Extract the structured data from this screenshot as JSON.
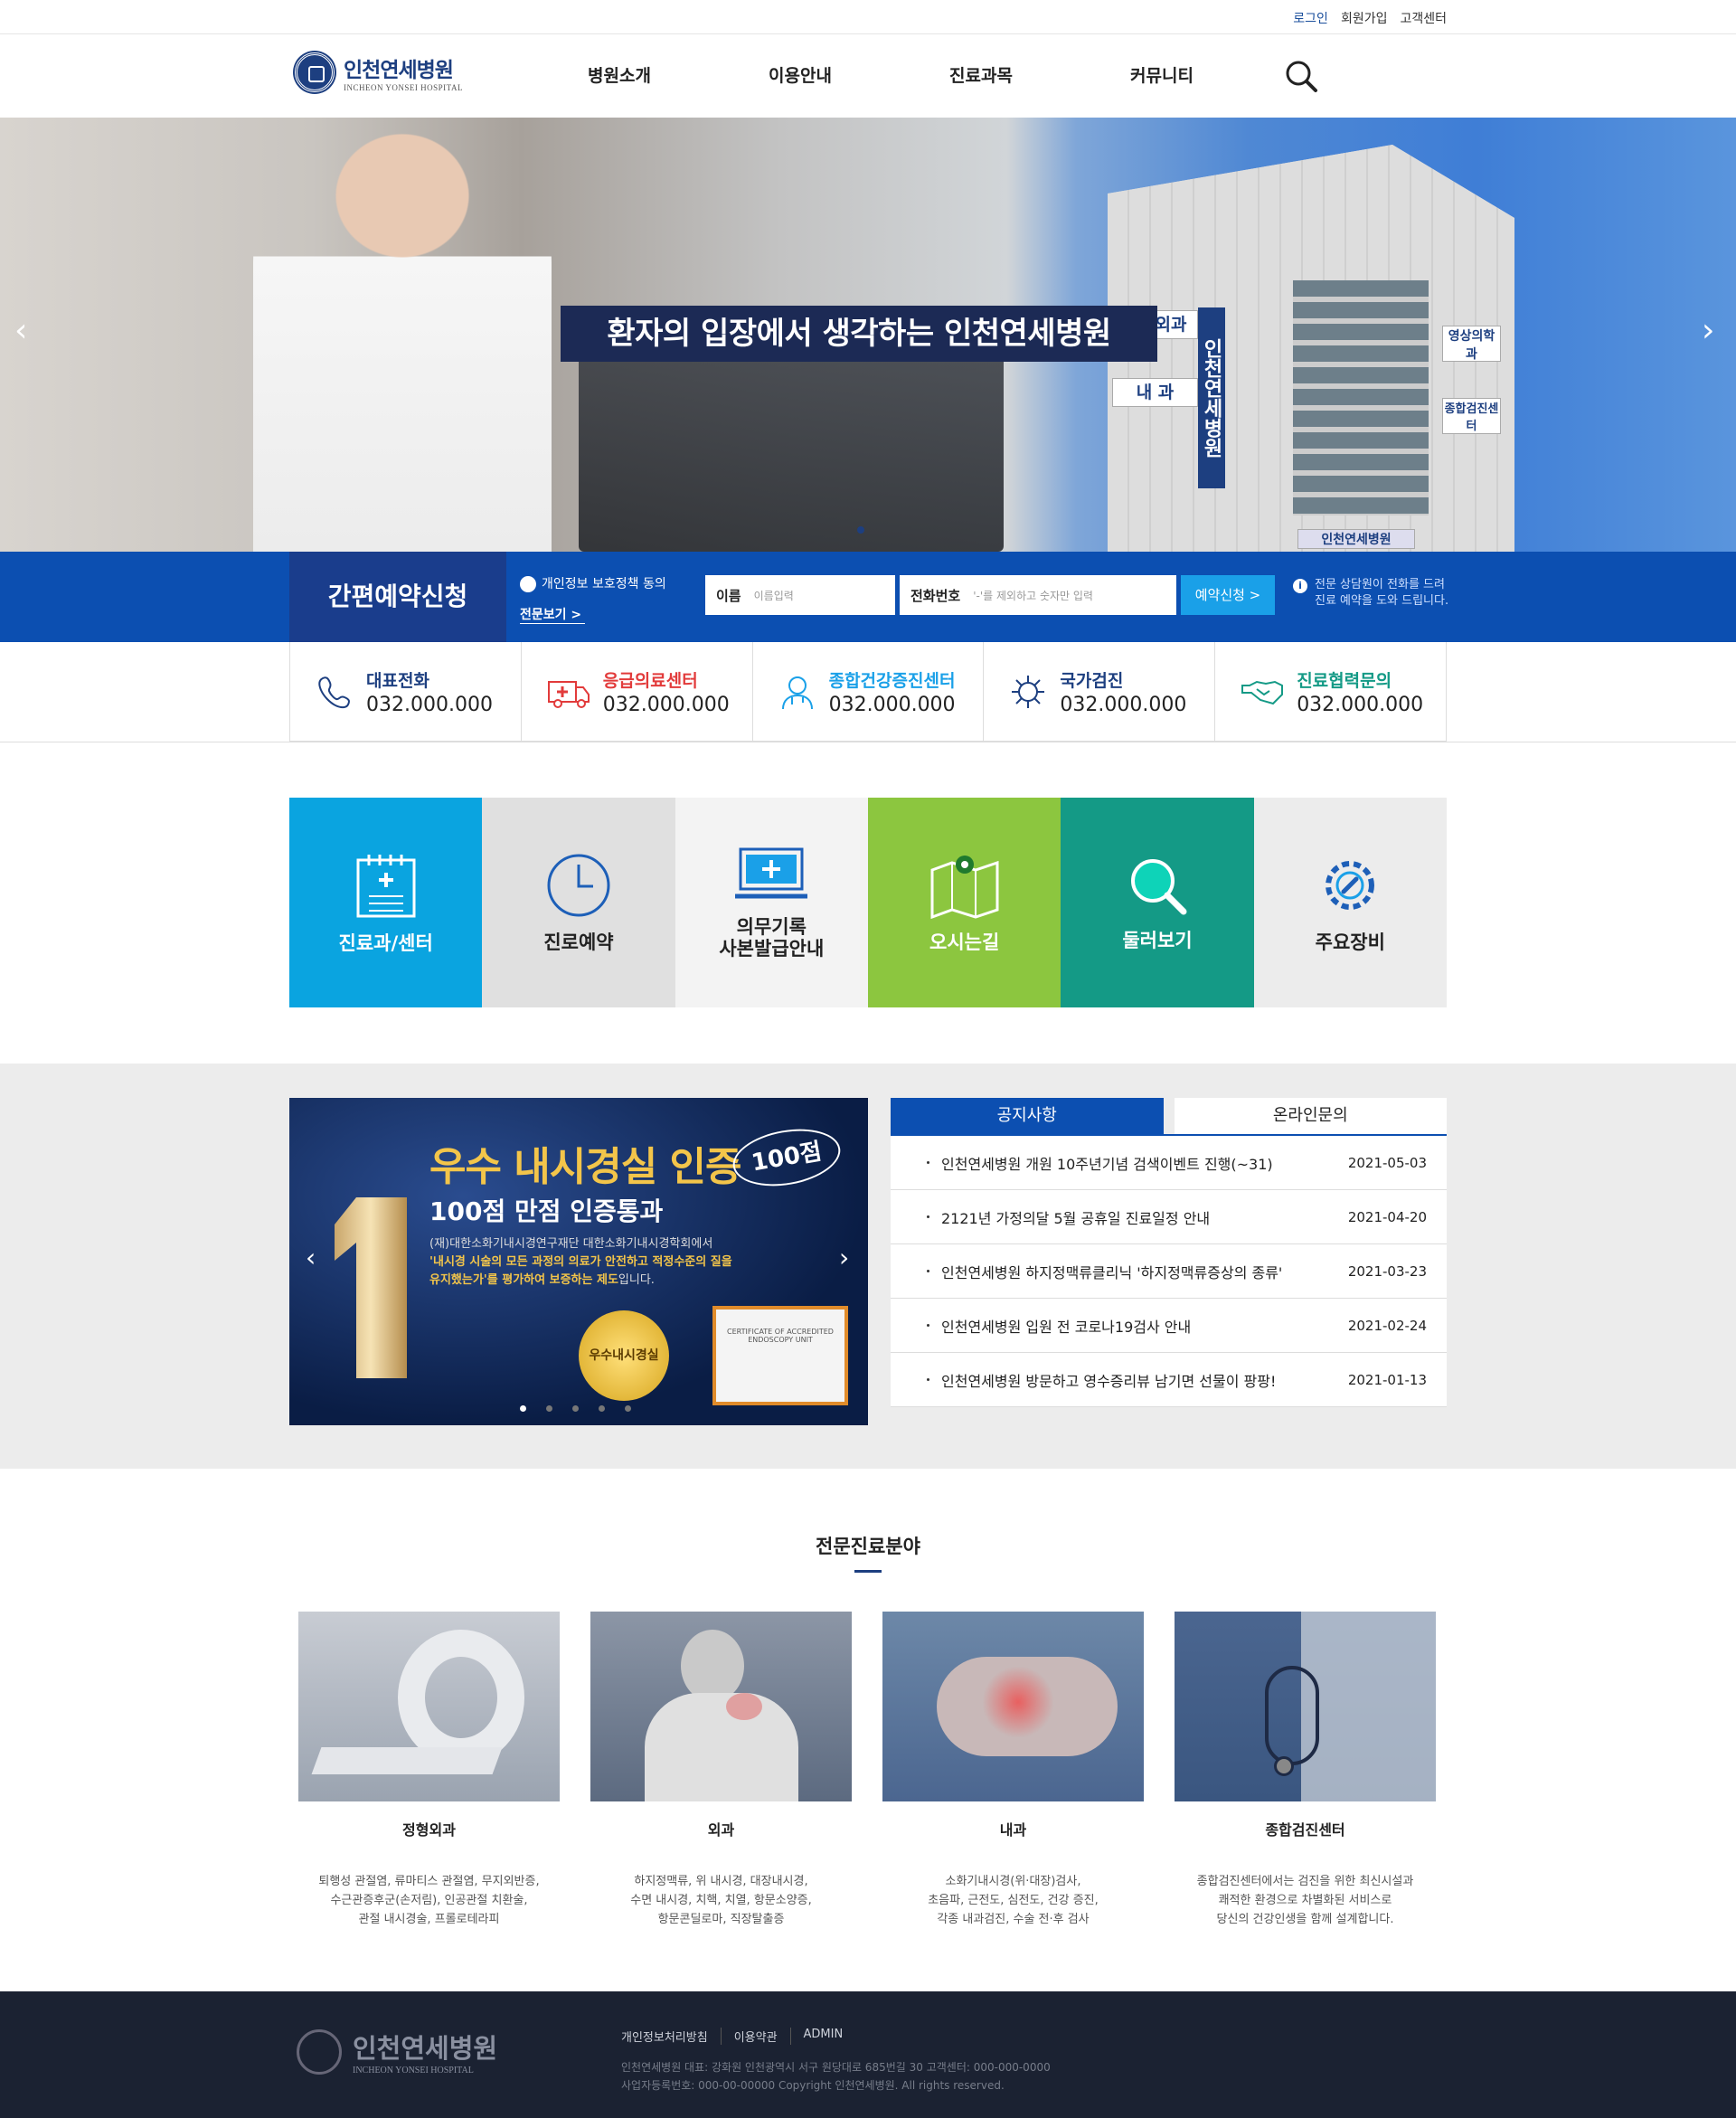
{
  "util": {
    "login": "로그인",
    "join": "회원가입",
    "support": "고객센터"
  },
  "logo": {
    "ko": "인천연세병원",
    "en": "INCHEON YONSEI HOSPITAL"
  },
  "nav": [
    "병원소개",
    "이용안내",
    "진료과목",
    "커뮤니티"
  ],
  "hero": {
    "title": "환자의 입장에서 생각하는 인천연세병원",
    "sign1": "정형외과",
    "sign2": "내  과",
    "sign3": "영상의학과",
    "sign4": "종합검진센터",
    "vertical": "인천연세병원",
    "building_name": "인천연세병원"
  },
  "reservation": {
    "title": "간편예약신청",
    "agree": "개인정보 보호정책 동의",
    "agree_more": "전문보기 >",
    "name_label": "이름",
    "name_placeholder": "이름입력",
    "phone_label": "전화번호",
    "phone_placeholder": "'-'를 제외하고 숫자만 입력",
    "submit": "예약신청 >",
    "note_line1": "전문 상담원이 전화를 드려",
    "note_line2": "진료 예약을 도와 드립니다."
  },
  "phones": [
    {
      "label": "대표전화",
      "number": "032.000.000",
      "color": "#1d3f80",
      "icon": "phone-icon"
    },
    {
      "label": "응급의료센터",
      "number": "032.000.000",
      "color": "#e23b3b",
      "icon": "ambulance-icon"
    },
    {
      "label": "종합건강증진센터",
      "number": "032.000.000",
      "color": "#1aa0e8",
      "icon": "doctor-icon"
    },
    {
      "label": "국가검진",
      "number": "032.000.000",
      "color": "#1d3f80",
      "icon": "virus-icon"
    },
    {
      "label": "진료협력문의",
      "number": "032.000.000",
      "color": "#149a86",
      "icon": "handshake-icon"
    }
  ],
  "tiles": [
    {
      "label": "진료과/센터",
      "bg": "#0aa4e0",
      "fg": "#ffffff",
      "icon": "clipboard-icon"
    },
    {
      "label": "진로예약",
      "bg": "#e0e0e0",
      "fg": "#222222",
      "icon": "clock-icon"
    },
    {
      "label1": "의무기록",
      "label2": "사본발급안내",
      "bg": "#f3f3f3",
      "fg": "#222222",
      "icon": "monitor-icon"
    },
    {
      "label": "오시는길",
      "bg": "#8cc63f",
      "fg": "#ffffff",
      "icon": "map-icon"
    },
    {
      "label": "둘러보기",
      "bg": "#149a86",
      "fg": "#ffffff",
      "icon": "magnifier-icon"
    },
    {
      "label": "주요장비",
      "bg": "#ececec",
      "fg": "#222222",
      "icon": "gear-icon"
    }
  ],
  "banner": {
    "title": "우수 내시경실 인증",
    "badge": "100점",
    "subtitle": "100점 만점 인증통과",
    "line1": "(재)대한소화기내시경연구재단 대한소화기내시경학회에서",
    "line2": "'내시경 시술의 모든 과정의 의료가 안전하고 적정수준의 질을",
    "line3": "유지했는가'를 평가하여 보증하는 제도",
    "line3_tail": "입니다.",
    "medal": "우수내시경실",
    "cert": "CERTIFICATE OF ACCREDITED ENDOSCOPY UNIT"
  },
  "notice": {
    "tabs": [
      "공지사항",
      "온라인문의"
    ],
    "items": [
      {
        "title": "인천연세병원 개원 10주년기념 검색이벤트 진행(~31)",
        "date": "2021-05-03"
      },
      {
        "title": "2121년 가정의달 5월 공휴일 진료일정 안내",
        "date": "2021-04-20"
      },
      {
        "title": "인천연세병원 하지정맥류클리닉 '하지정맥류증상의 종류'",
        "date": "2021-03-23"
      },
      {
        "title": "인천연세병원 입원 전 코로나19검사 안내",
        "date": "2021-02-24"
      },
      {
        "title": "인천연세병원 방문하고 영수증리뷰 남기면 선물이 팡팡!",
        "date": "2021-01-13"
      }
    ]
  },
  "specialty": {
    "title": "전문진료분야",
    "cards": [
      {
        "name": "정형외과",
        "desc1": "퇴행성 관절염, 류마티스 관절염, 무지외반증,",
        "desc2": "수근관증후군(손저림), 인공관절 치환술,",
        "desc3": "관절 내시경술, 프롤로테라피"
      },
      {
        "name": "외과",
        "desc1": "하지정맥류, 위 내시경, 대장내시경,",
        "desc2": "수면 내시경, 치핵, 치열, 항문소양증,",
        "desc3": "항문콘딜로마, 직장탈출증"
      },
      {
        "name": "내과",
        "desc1": "소화기내시경(위·대장)검사,",
        "desc2": "초음파, 근전도, 심전도, 건강 증진,",
        "desc3": "각종 내과검진, 수술 전·후 검사"
      },
      {
        "name": "종합검진센터",
        "desc1": "종합검진센터에서는 검진을 위한 최신시설과",
        "desc2": "쾌적한 환경으로 차별화된 서비스로",
        "desc3": "당신의 건강인생을 함께 설계합니다."
      }
    ]
  },
  "footer": {
    "links": [
      "개인정보처리방침",
      "이용약관",
      "ADMIN"
    ],
    "info1": "인천연세병원    대표: 강화원    인천광역시 서구 원당대로 685번길 30    고객센터: 000-000-0000",
    "info2": "사업자등록번호: 000-00-00000    Copyright 인천연세병원. All rights reserved."
  }
}
